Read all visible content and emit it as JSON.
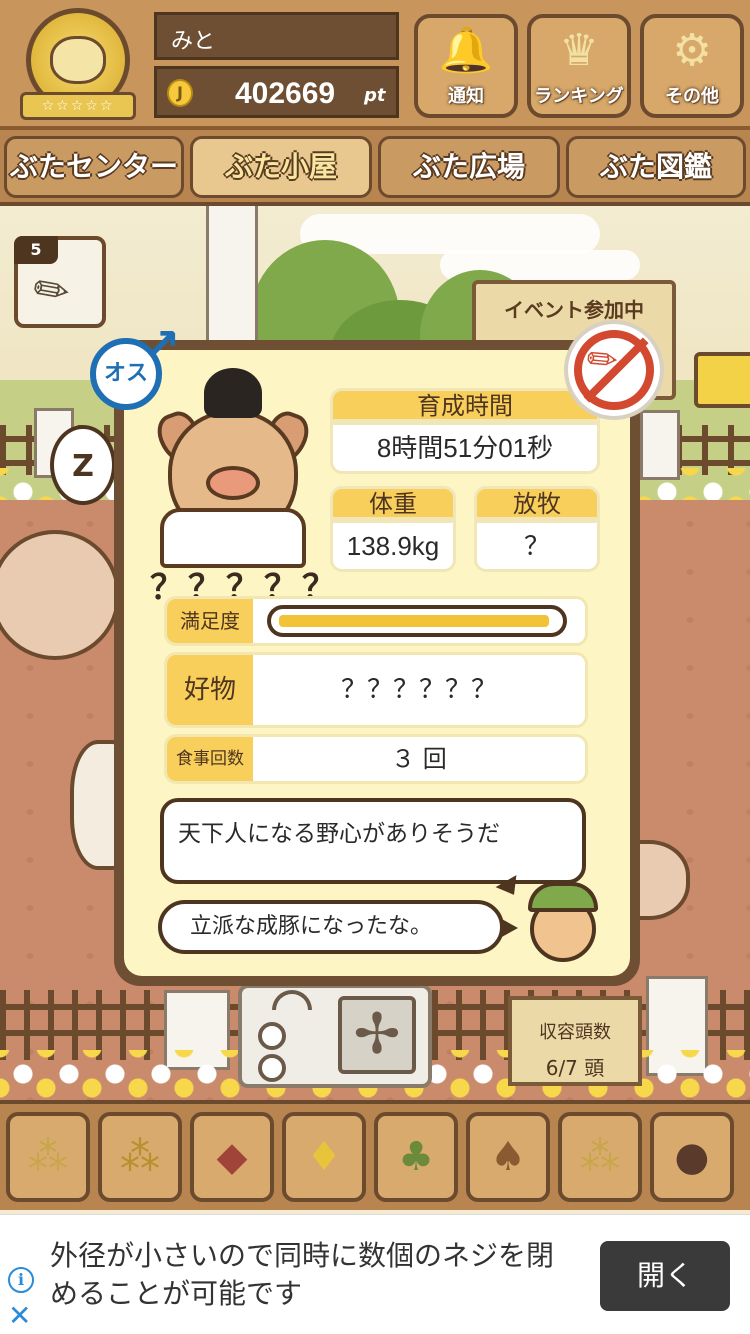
{
  "header": {
    "user_name": "みと",
    "points": "402669",
    "points_unit": "pt",
    "coin_glyph": "J",
    "medal_stars": "☆☆☆☆☆",
    "buttons": [
      {
        "label": "通知",
        "icon": "bell-icon",
        "glyph": "🔔"
      },
      {
        "label": "ランキング",
        "icon": "crown-icon",
        "glyph": "♛"
      },
      {
        "label": "その他",
        "icon": "gear-icon",
        "glyph": "⚙"
      }
    ]
  },
  "nav": {
    "tabs": [
      {
        "label": "ぶたセンター",
        "active": false
      },
      {
        "label": "ぶた小屋",
        "active": true
      },
      {
        "label": "ぶた広場",
        "active": false
      },
      {
        "label": "ぶた図鑑",
        "active": false
      }
    ]
  },
  "side_item": {
    "count": "5",
    "icon": "syringe-icon"
  },
  "event_sign": "イベント参加中",
  "badges": {
    "gender_label": "オス",
    "gender_icon": "male-icon",
    "status_icon": "no-syringe-icon"
  },
  "pig": {
    "name": "？？？？？",
    "stats": {
      "growth_time_label": "育成時間",
      "growth_time_value": "8時間51分01秒",
      "weight_label": "体重",
      "weight_value": "138.9kg",
      "pasture_label": "放牧",
      "pasture_value": "？",
      "satisfaction_label": "満足度",
      "satisfaction_level": 0.98,
      "favorite_label": "好物",
      "favorite_value": "？？？？？？",
      "meals_label": "食事回数",
      "meals_value": "３ 回"
    },
    "comment": "天下人になる野心がありそうだ",
    "farmer_speech": "立派な成豚になったな。"
  },
  "capacity": {
    "label": "収容頭数",
    "value": "6/7 頭"
  },
  "food_items": [
    {
      "name": "grain-pile-icon",
      "glyph": "●●",
      "color": "#d9c27a"
    },
    {
      "name": "beans-icon",
      "glyph": "●●",
      "color": "#c9a64a"
    },
    {
      "name": "sweet-potato-icon",
      "glyph": "🍠",
      "color": "#a0443a"
    },
    {
      "name": "corn-icon",
      "glyph": "🌽",
      "color": "#e8c43a"
    },
    {
      "name": "soybean-plant-icon",
      "glyph": "🌱",
      "color": "#6b8a3a"
    },
    {
      "name": "acorn-icon",
      "glyph": "🌰",
      "color": "#8a5a30"
    },
    {
      "name": "grain-plate-icon",
      "glyph": "●●",
      "color": "#d9c27a"
    },
    {
      "name": "truffle-plate-icon",
      "glyph": "●●",
      "color": "#5a3a2a"
    }
  ],
  "ad": {
    "text": "外径が小さいので同時に数個のネジを閉めることが可能です",
    "button": "開く",
    "info_glyph": "i",
    "close_glyph": "✕"
  }
}
